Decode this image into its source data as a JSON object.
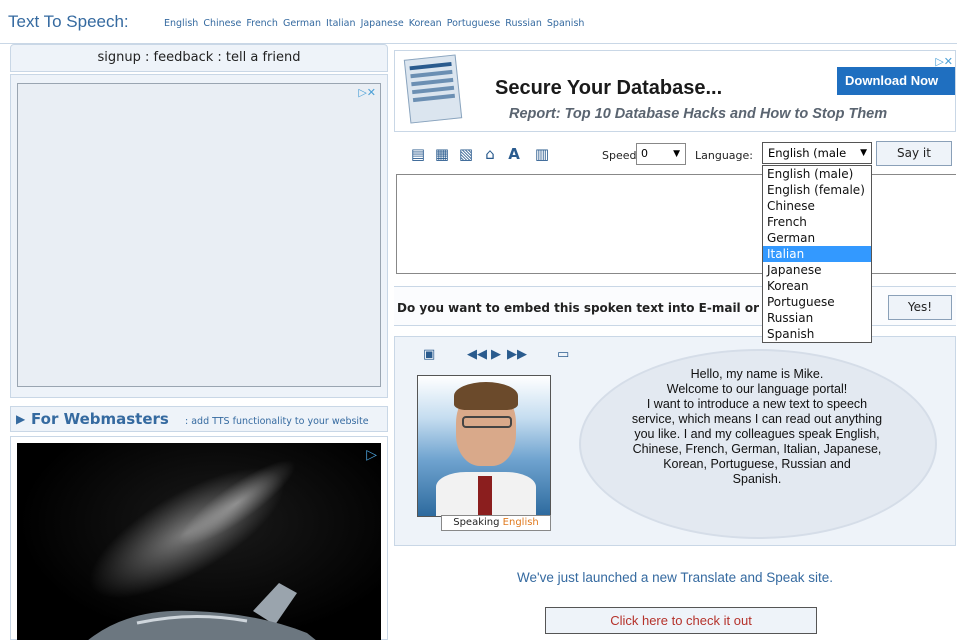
{
  "header": {
    "title": "Text To Speech:",
    "languages": [
      "English",
      "Chinese",
      "French",
      "German",
      "Italian",
      "Japanese",
      "Korean",
      "Portuguese",
      "Russian",
      "Spanish"
    ]
  },
  "left": {
    "signup": "signup",
    "feedback": "feedback",
    "tell_friend": "tell a friend",
    "separator": " : ",
    "webmasters_title": "For Webmasters",
    "webmasters_desc": ": add TTS functionality to your website"
  },
  "top_ad": {
    "headline": "Secure Your Database...",
    "subline": "Report: Top 10 Database Hacks and How to Stop Them",
    "button": "Download Now"
  },
  "toolbar": {
    "speed_label": "Speed:",
    "speed_value": "0",
    "language_label": "Language:",
    "language_value": "English (male",
    "say_it": "Say it",
    "icons": [
      "new-document-icon",
      "open-document-icon",
      "clear-document-icon",
      "delete-icon",
      "font-size-icon",
      "keyboard-icon"
    ]
  },
  "language_options": [
    "English (male)",
    "English (female)",
    "Chinese",
    "French",
    "German",
    "Italian",
    "Japanese",
    "Korean",
    "Portuguese",
    "Russian",
    "Spanish"
  ],
  "highlighted_option": "Italian",
  "embed": {
    "text": "Do you want to embed this spoken text into E-mail or",
    "yes": "Yes!"
  },
  "avatar": {
    "speaking": "Speaking",
    "speaking_lang": "English",
    "speech_lines": [
      "Hello, my name is Mike.",
      "Welcome to our language portal!",
      "I want to introduce a new text to speech",
      "service, which means I can read out anything",
      "you like. I and my colleagues speak English,",
      "Chinese, French, German, Italian, Japanese,",
      "Korean, Portuguese, Russian and",
      "Spanish."
    ]
  },
  "launch": {
    "text": "We've just launched a new Translate and Speak site.",
    "button": "Click here to check it out"
  },
  "colors": {
    "link_blue": "#356aa0",
    "panel_bg": "#eef3f9",
    "highlight": "#3399ff",
    "button_text_red": "#b5322b",
    "speaking_orange": "#e07a1f"
  }
}
